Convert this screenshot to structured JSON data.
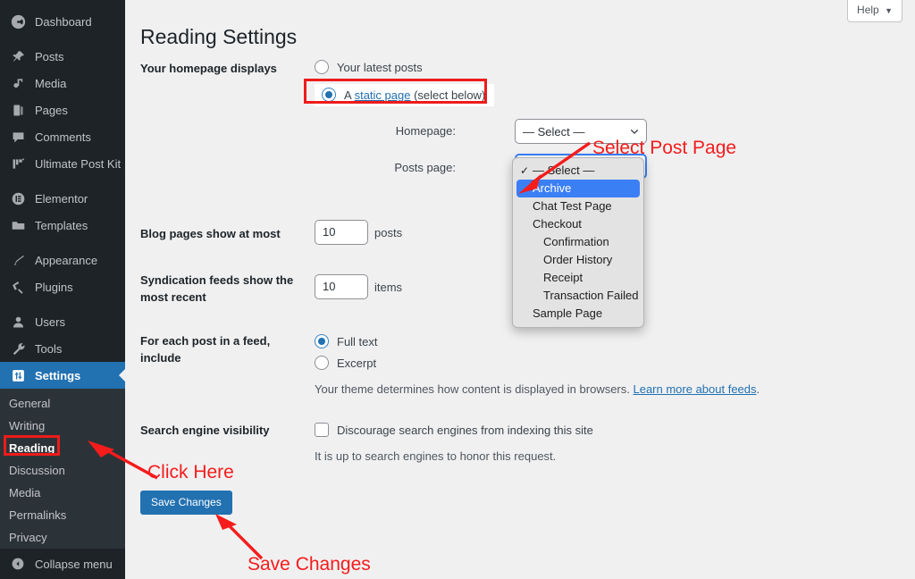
{
  "sidebar": {
    "items": [
      {
        "label": "Dashboard",
        "icon": "dashboard-icon"
      },
      {
        "label": "Posts",
        "icon": "pin-icon"
      },
      {
        "label": "Media",
        "icon": "media-icon"
      },
      {
        "label": "Pages",
        "icon": "pages-icon"
      },
      {
        "label": "Comments",
        "icon": "comments-icon"
      },
      {
        "label": "Ultimate Post Kit",
        "icon": "ultimate-post-kit-icon"
      },
      {
        "label": "Elementor",
        "icon": "elementor-icon"
      },
      {
        "label": "Templates",
        "icon": "folder-icon"
      },
      {
        "label": "Appearance",
        "icon": "brush-icon"
      },
      {
        "label": "Plugins",
        "icon": "plug-icon"
      },
      {
        "label": "Users",
        "icon": "user-icon"
      },
      {
        "label": "Tools",
        "icon": "wrench-icon"
      },
      {
        "label": "Settings",
        "icon": "settings-icon"
      }
    ],
    "submenu": [
      {
        "label": "General"
      },
      {
        "label": "Writing"
      },
      {
        "label": "Reading"
      },
      {
        "label": "Discussion"
      },
      {
        "label": "Media"
      },
      {
        "label": "Permalinks"
      },
      {
        "label": "Privacy"
      }
    ],
    "collapse_label": "Collapse menu"
  },
  "header": {
    "help_label": "Help",
    "help_caret": "▼",
    "page_title": "Reading Settings"
  },
  "form": {
    "homepage_displays": {
      "label": "Your homepage displays",
      "option_latest": "Your latest posts",
      "option_static_prefix": "A ",
      "option_static_link": "static page",
      "option_static_suffix": " (select below)"
    },
    "homepage_select": {
      "label": "Homepage:",
      "value": "— Select —"
    },
    "posts_page_select": {
      "label": "Posts page:",
      "value": "— Select —"
    },
    "blog_pages": {
      "label": "Blog pages show at most",
      "value": "10",
      "unit": "posts"
    },
    "syndication": {
      "label": "Syndication feeds show the most recent",
      "value": "10",
      "unit": "items"
    },
    "feed_include": {
      "label": "For each post in a feed, include",
      "option_full": "Full text",
      "option_excerpt": "Excerpt",
      "description_text": "Your theme determines how content is displayed in browsers. ",
      "description_link": "Learn more about feeds",
      "description_period": "."
    },
    "search_visibility": {
      "label": "Search engine visibility",
      "checkbox_label": "Discourage search engines from indexing this site",
      "note": "It is up to search engines to honor this request."
    },
    "save_label": "Save Changes"
  },
  "dropdown": {
    "options": [
      {
        "label": "— Select —",
        "state": "checked",
        "indent": false
      },
      {
        "label": "Archive",
        "state": "highlighted",
        "indent": false
      },
      {
        "label": "Chat Test Page",
        "state": "normal",
        "indent": false
      },
      {
        "label": "Checkout",
        "state": "normal",
        "indent": false
      },
      {
        "label": "Confirmation",
        "state": "normal",
        "indent": true
      },
      {
        "label": "Order History",
        "state": "normal",
        "indent": true
      },
      {
        "label": "Receipt",
        "state": "normal",
        "indent": true
      },
      {
        "label": "Transaction Failed",
        "state": "normal",
        "indent": true
      },
      {
        "label": "Sample Page",
        "state": "normal",
        "indent": false
      }
    ]
  },
  "annotations": {
    "select_post_page": "Select Post Page",
    "click_here": "Click Here",
    "save_changes": "Save Changes",
    "color": "#f51c1c"
  }
}
